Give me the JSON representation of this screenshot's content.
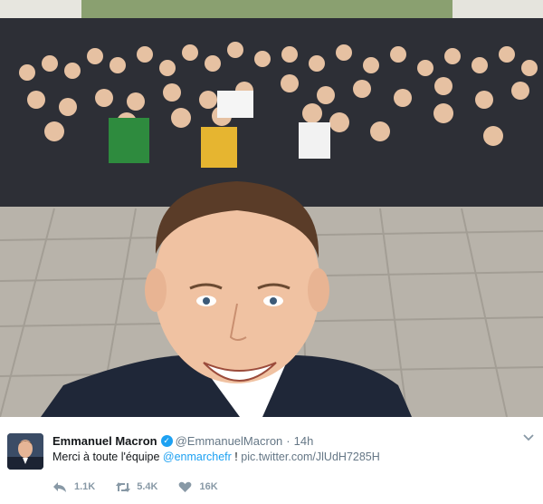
{
  "tweet": {
    "display_name": "Emmanuel Macron",
    "handle": "@EmmanuelMacron",
    "separator": "·",
    "time": "14h",
    "text_prefix": "Merci à toute l'équipe ",
    "mention": "@enmarchefr",
    "text_middle": " ! ",
    "link": "pic.twitter.com/JlUdH7285H"
  },
  "actions": {
    "reply_count": "1.1K",
    "retweet_count": "5.4K",
    "like_count": "16K"
  },
  "icons": {
    "verified": "verified-badge-icon",
    "menu": "chevron-down-icon",
    "reply": "reply-icon",
    "retweet": "retweet-icon",
    "like": "heart-icon"
  },
  "colors": {
    "link_blue": "#1da1f2",
    "muted_gray": "#657786",
    "icon_gray": "#8899a6"
  }
}
